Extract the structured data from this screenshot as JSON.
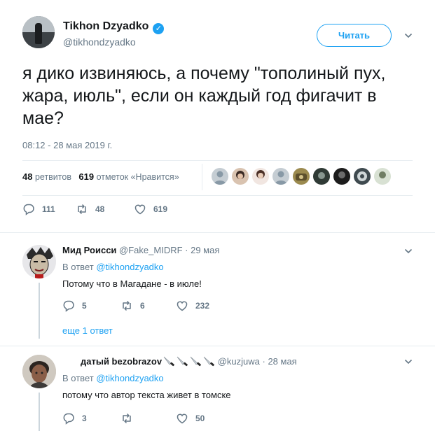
{
  "main_tweet": {
    "author_name": "Tikhon Dzyadko",
    "author_handle": "@tikhondzyadko",
    "follow_label": "Читать",
    "text": "я дико извиняюсь, а почему \"тополиный пух, жара, июль\", если он каждый год фигачит в мае?",
    "timestamp": "08:12 - 28 мая 2019 г.",
    "retweets_count": "48",
    "retweets_label": "ретвитов",
    "likes_count": "619",
    "likes_label": "отметок «Нравится»",
    "actions": {
      "replies": "111",
      "retweets": "48",
      "likes": "619"
    }
  },
  "replies": [
    {
      "author_name": "Мид Роисси",
      "author_handle": "@Fake_MIDRF",
      "date": "· 29 мая",
      "in_reply_prefix": "В ответ",
      "in_reply_handle": "@tikhondzyadko",
      "text": "Потому что в Магадане - в июле!",
      "actions": {
        "replies": "5",
        "retweets": "6",
        "likes": "232"
      },
      "more_replies": "еще 1 ответ"
    },
    {
      "author_name": "датый bezobrazov",
      "author_handle": "@kuzjuwa",
      "date": "· 28 мая",
      "in_reply_prefix": "В ответ",
      "in_reply_handle": "@tikhondzyadko",
      "text": "потому что автор текста живет в томске",
      "actions": {
        "replies": "3",
        "retweets": "",
        "likes": "50"
      }
    }
  ],
  "icons": {
    "verified": "verified-badge-icon",
    "caret": "chevron-down-icon",
    "reply": "reply-icon",
    "retweet": "retweet-icon",
    "like": "heart-icon",
    "emoji": "knife-emoji-icon"
  },
  "colors": {
    "accent": "#1da1f2",
    "text": "#14171a",
    "secondary": "#657786",
    "border": "#e6ecf0"
  }
}
